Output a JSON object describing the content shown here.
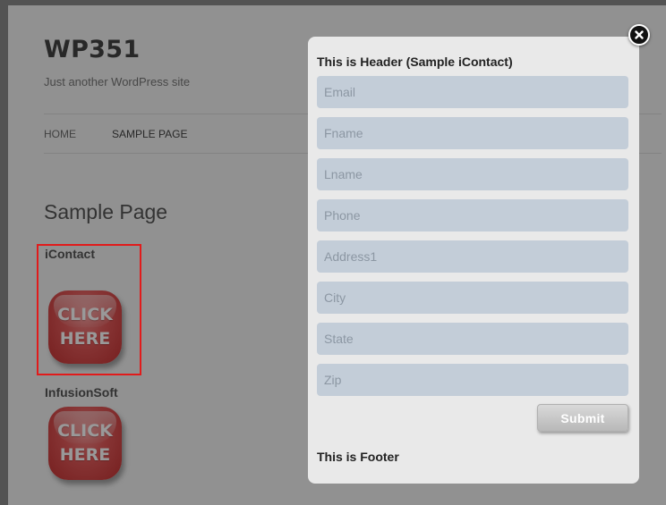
{
  "site": {
    "title": "WP351",
    "tagline": "Just another WordPress site"
  },
  "nav": {
    "items": [
      {
        "label": "HOME"
      },
      {
        "label": "SAMPLE PAGE"
      }
    ]
  },
  "content": {
    "page_title": "Sample Page",
    "sections": [
      {
        "label": "iContact",
        "button_line1": "CLICK",
        "button_line2": "HERE"
      },
      {
        "label": "InfusionSoft",
        "button_line1": "CLICK",
        "button_line2": "HERE"
      }
    ]
  },
  "modal": {
    "header": "This is Header (Sample iContact)",
    "fields": [
      {
        "placeholder": "Email",
        "value": ""
      },
      {
        "placeholder": "Fname",
        "value": ""
      },
      {
        "placeholder": "Lname",
        "value": ""
      },
      {
        "placeholder": "Phone",
        "value": ""
      },
      {
        "placeholder": "Address1",
        "value": ""
      },
      {
        "placeholder": "City",
        "value": ""
      },
      {
        "placeholder": "State",
        "value": ""
      },
      {
        "placeholder": "Zip",
        "value": ""
      }
    ],
    "submit_label": "Submit",
    "footer": "This is Footer"
  },
  "colors": {
    "highlight_border": "#e11b1b",
    "field_background": "#c3cdd8",
    "button_red": "#e25a5a"
  },
  "icons": {
    "close": "close-icon"
  }
}
